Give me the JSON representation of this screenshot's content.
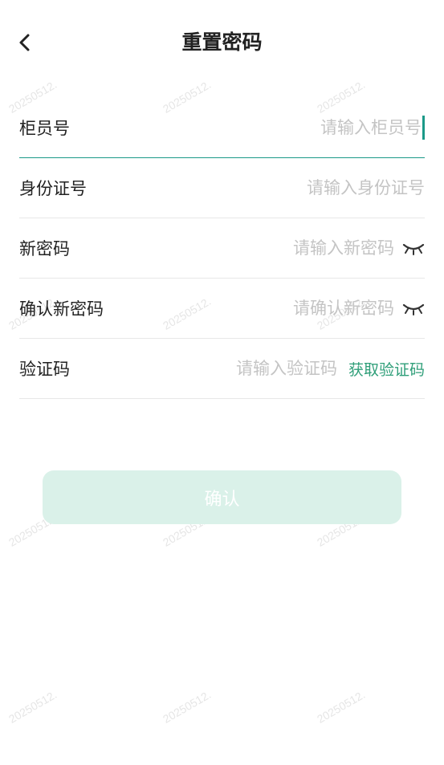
{
  "header": {
    "title": "重置密码",
    "back_icon": "chevron-left-icon"
  },
  "form": {
    "teller_id": {
      "label": "柜员号",
      "placeholder": "请输入柜员号",
      "value": ""
    },
    "id_number": {
      "label": "身份证号",
      "placeholder": "请输入身份证号",
      "value": ""
    },
    "new_password": {
      "label": "新密码",
      "placeholder": "请输入新密码",
      "value": "",
      "toggle_icon": "eye-closed-icon"
    },
    "confirm_password": {
      "label": "确认新密码",
      "placeholder": "请确认新密码",
      "value": "",
      "toggle_icon": "eye-closed-icon"
    },
    "verification_code": {
      "label": "验证码",
      "placeholder": "请输入验证码",
      "value": "",
      "get_code_label": "获取验证码"
    }
  },
  "confirm_button": {
    "label": "确认"
  },
  "watermark": {
    "text": "20250512."
  },
  "colors": {
    "accent": "#1b9988",
    "link_green": "#2e9e78",
    "button_bg_disabled": "#daf1e9",
    "placeholder": "#c4c4c4",
    "divider": "#e7e7e7"
  }
}
